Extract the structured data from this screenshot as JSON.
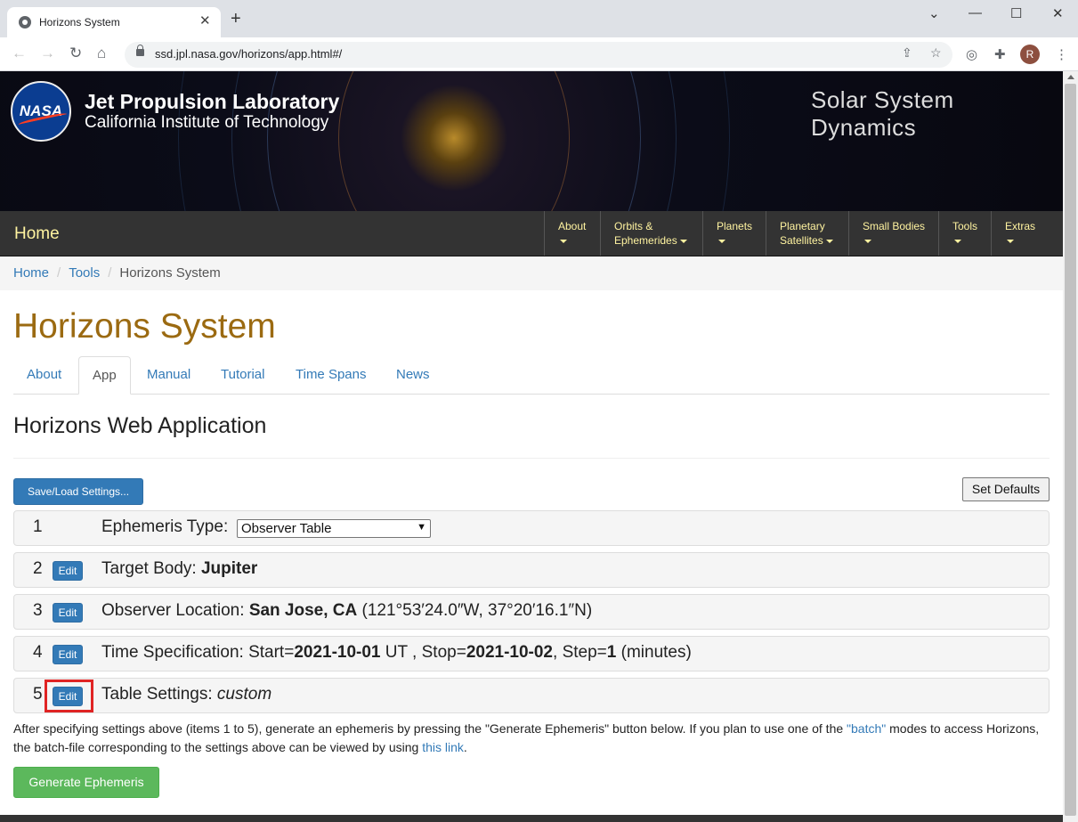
{
  "browser": {
    "tab_title": "Horizons System",
    "new_tab_icon": "+",
    "url": "ssd.jpl.nasa.gov/horizons/app.html#/",
    "avatar_initial": "R"
  },
  "banner": {
    "logo_text": "NASA",
    "lab_name": "Jet Propulsion Laboratory",
    "lab_sub": "California Institute of Technology",
    "site_title": "Solar System Dynamics"
  },
  "navbar": {
    "home": "Home",
    "items": [
      {
        "line1": "About",
        "line2": ""
      },
      {
        "line1": "Orbits &",
        "line2": "Ephemerides"
      },
      {
        "line1": "Planets",
        "line2": ""
      },
      {
        "line1": "Planetary",
        "line2": "Satellites"
      },
      {
        "line1": "Small Bodies",
        "line2": ""
      },
      {
        "line1": "Tools",
        "line2": ""
      },
      {
        "line1": "Extras",
        "line2": ""
      }
    ]
  },
  "breadcrumb": {
    "home": "Home",
    "tools": "Tools",
    "current": "Horizons System"
  },
  "page": {
    "title": "Horizons System"
  },
  "tabs": [
    "About",
    "App",
    "Manual",
    "Tutorial",
    "Time Spans",
    "News"
  ],
  "app": {
    "section_title": "Horizons Web Application",
    "save_load_label": "Save/Load Settings...",
    "set_defaults_label": "Set Defaults",
    "edit_label": "Edit",
    "rows": {
      "r1": {
        "num": "1",
        "label": "Ephemeris Type:",
        "select_value": "Observer Table"
      },
      "r2": {
        "num": "2",
        "label": "Target Body:",
        "value": "Jupiter"
      },
      "r3": {
        "num": "3",
        "label": "Observer Location:",
        "value": "San Jose, CA",
        "extra": "(121°53′24.0″W, 37°20′16.1″N)"
      },
      "r4": {
        "num": "4",
        "label": "Time Specification: Start=",
        "start": "2021-10-01",
        "mid": "UT , Stop=",
        "stop": "2021-10-02",
        "step_label": ", Step=",
        "step": "1",
        "unit": "(minutes)"
      },
      "r5": {
        "num": "5",
        "label": "Table Settings:",
        "value": "custom"
      }
    },
    "note": {
      "p1": "After specifying settings above (items 1 to 5), generate an ephemeris by pressing the \"Generate Ephemeris\" button below. If you plan to use one of the ",
      "link1": "\"batch\"",
      "p2": " modes to access Horizons, the batch-file corresponding to the settings above can be viewed by using ",
      "link2": "this link",
      "p3": "."
    },
    "generate_label": "Generate Ephemeris"
  },
  "colors": {
    "title_gold": "#9b6a11",
    "link_blue": "#337ab7",
    "nav_yellow": "#fff3a0",
    "generate_green": "#5cb85c",
    "highlight_red": "#e02424"
  }
}
